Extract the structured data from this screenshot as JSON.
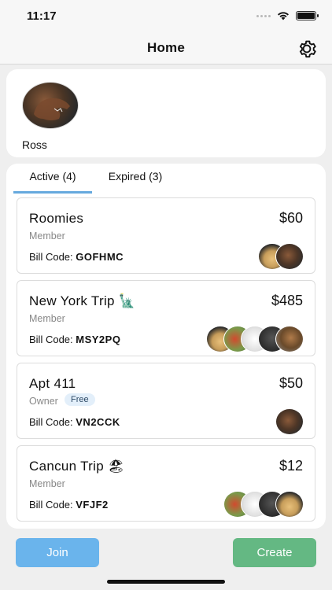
{
  "status_bar": {
    "time": "11:17",
    "icons": [
      "signal-icon",
      "wifi-icon",
      "battery-icon"
    ],
    "battery_level": 1.0
  },
  "nav": {
    "title": "Home",
    "settings_icon": "gear-icon"
  },
  "profile": {
    "name": "Ross",
    "avatar": "dinosaur-avatar"
  },
  "tabs": [
    {
      "label": "Active (4)",
      "active": true
    },
    {
      "label": "Expired (3)",
      "active": false
    }
  ],
  "bills": [
    {
      "name": "Roomies",
      "amount": "$60",
      "role": "Member",
      "code_label": "Bill Code:",
      "code": "GOFHMC",
      "members": [
        "dino",
        "dog"
      ]
    },
    {
      "name": "New York Trip 🗽",
      "amount": "$485",
      "role": "Member",
      "code_label": "Bill Code:",
      "code": "MSY2PQ",
      "members": [
        "horse",
        "dark",
        "white",
        "flower",
        "dog"
      ]
    },
    {
      "name": "Apt 411",
      "amount": "$50",
      "role": "Owner",
      "badge": "Free",
      "code_label": "Bill Code:",
      "code": "VN2CCK",
      "members": [
        "dino"
      ]
    },
    {
      "name": "Cancun Trip 🏖",
      "amount": "$12",
      "role": "Member",
      "code_label": "Bill Code:",
      "code": "VFJF2",
      "members": [
        "dog",
        "dark",
        "white",
        "flower"
      ]
    }
  ],
  "actions": {
    "join_label": "Join",
    "create_label": "Create"
  },
  "colors": {
    "tab_underline": "#66a9de",
    "join_button": "#6ab4ec",
    "create_button": "#64b883",
    "free_badge_bg": "#e3effa"
  }
}
